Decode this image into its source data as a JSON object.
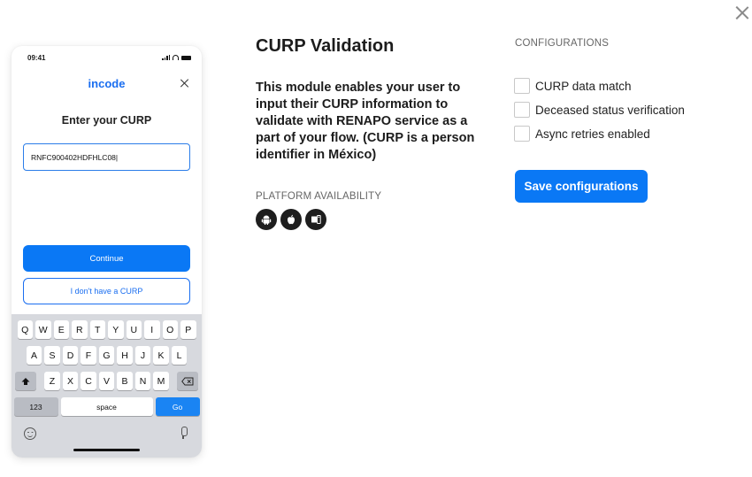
{
  "modal": {
    "close_icon": "close-icon"
  },
  "phone": {
    "status_time": "09:41",
    "brand": "incode",
    "heading": "Enter your CURP",
    "input_value": "RNFC900402HDFHLC08|",
    "continue_label": "Continue",
    "no_curp_label": "I don't have a CURP",
    "keyboard": {
      "row1": [
        "Q",
        "W",
        "E",
        "R",
        "T",
        "Y",
        "U",
        "I",
        "O",
        "P"
      ],
      "row2": [
        "A",
        "S",
        "D",
        "F",
        "G",
        "H",
        "J",
        "K",
        "L"
      ],
      "row3": [
        "Z",
        "X",
        "C",
        "V",
        "B",
        "N",
        "M"
      ],
      "numbers_key": "123",
      "space_key": "space",
      "go_key": "Go"
    }
  },
  "module": {
    "title": "CURP Validation",
    "description": "This module enables your user to input their CURP information to validate with RENAPO service as a part of your flow. (CURP is a person identifier in México)",
    "platform_label": "PLATFORM AVAILABILITY",
    "platforms": [
      "android-icon",
      "apple-icon",
      "web-icon"
    ]
  },
  "configurations": {
    "label": "CONFIGURATIONS",
    "options": [
      {
        "label": "CURP data match",
        "checked": false
      },
      {
        "label": "Deceased status verification",
        "checked": false
      },
      {
        "label": "Async retries enabled",
        "checked": false
      }
    ],
    "save_label": "Save configurations"
  },
  "colors": {
    "primary": "#0a78f5",
    "brand": "#1a6ef0",
    "keyboard_bg": "#d7d9de"
  }
}
